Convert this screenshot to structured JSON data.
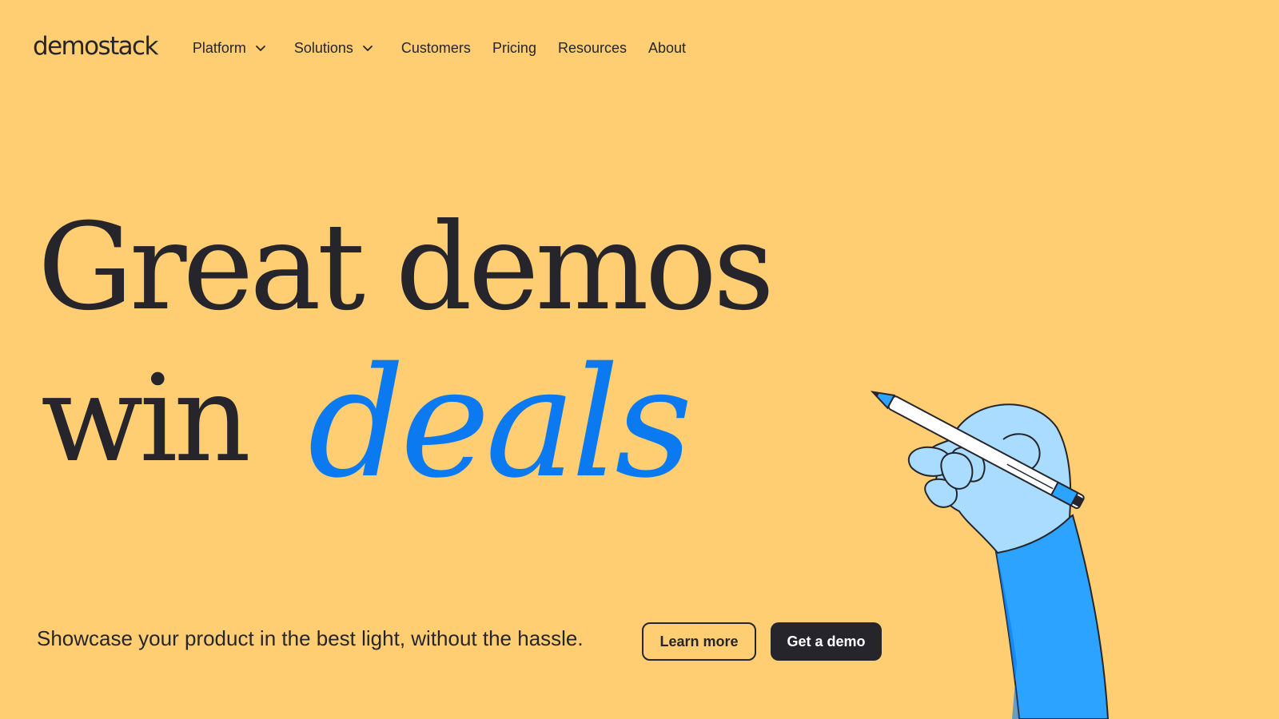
{
  "brand": {
    "logo_text": "demostack"
  },
  "nav": {
    "items": [
      {
        "label": "Platform",
        "has_menu": true
      },
      {
        "label": "Solutions",
        "has_menu": true
      },
      {
        "label": "Customers",
        "has_menu": false
      },
      {
        "label": "Pricing",
        "has_menu": false
      },
      {
        "label": "Resources",
        "has_menu": false
      },
      {
        "label": "About",
        "has_menu": false
      }
    ]
  },
  "hero": {
    "headline_line1": "Great demos",
    "headline_line2_prefix": "win",
    "headline_script_word": "deals",
    "tagline": "Showcase your product in the best light, without the hassle.",
    "cta_secondary": "Learn more",
    "cta_primary": "Get a demo"
  },
  "colors": {
    "background": "#FFCE73",
    "text_dark": "#26252B",
    "accent_blue": "#0B7AF0",
    "button_dark": "#26252B",
    "button_dark_text": "#FFFFFF"
  },
  "icons": {
    "menu_chevron": "chevron-down-icon",
    "illustration": "hand-holding-pen-illustration"
  }
}
